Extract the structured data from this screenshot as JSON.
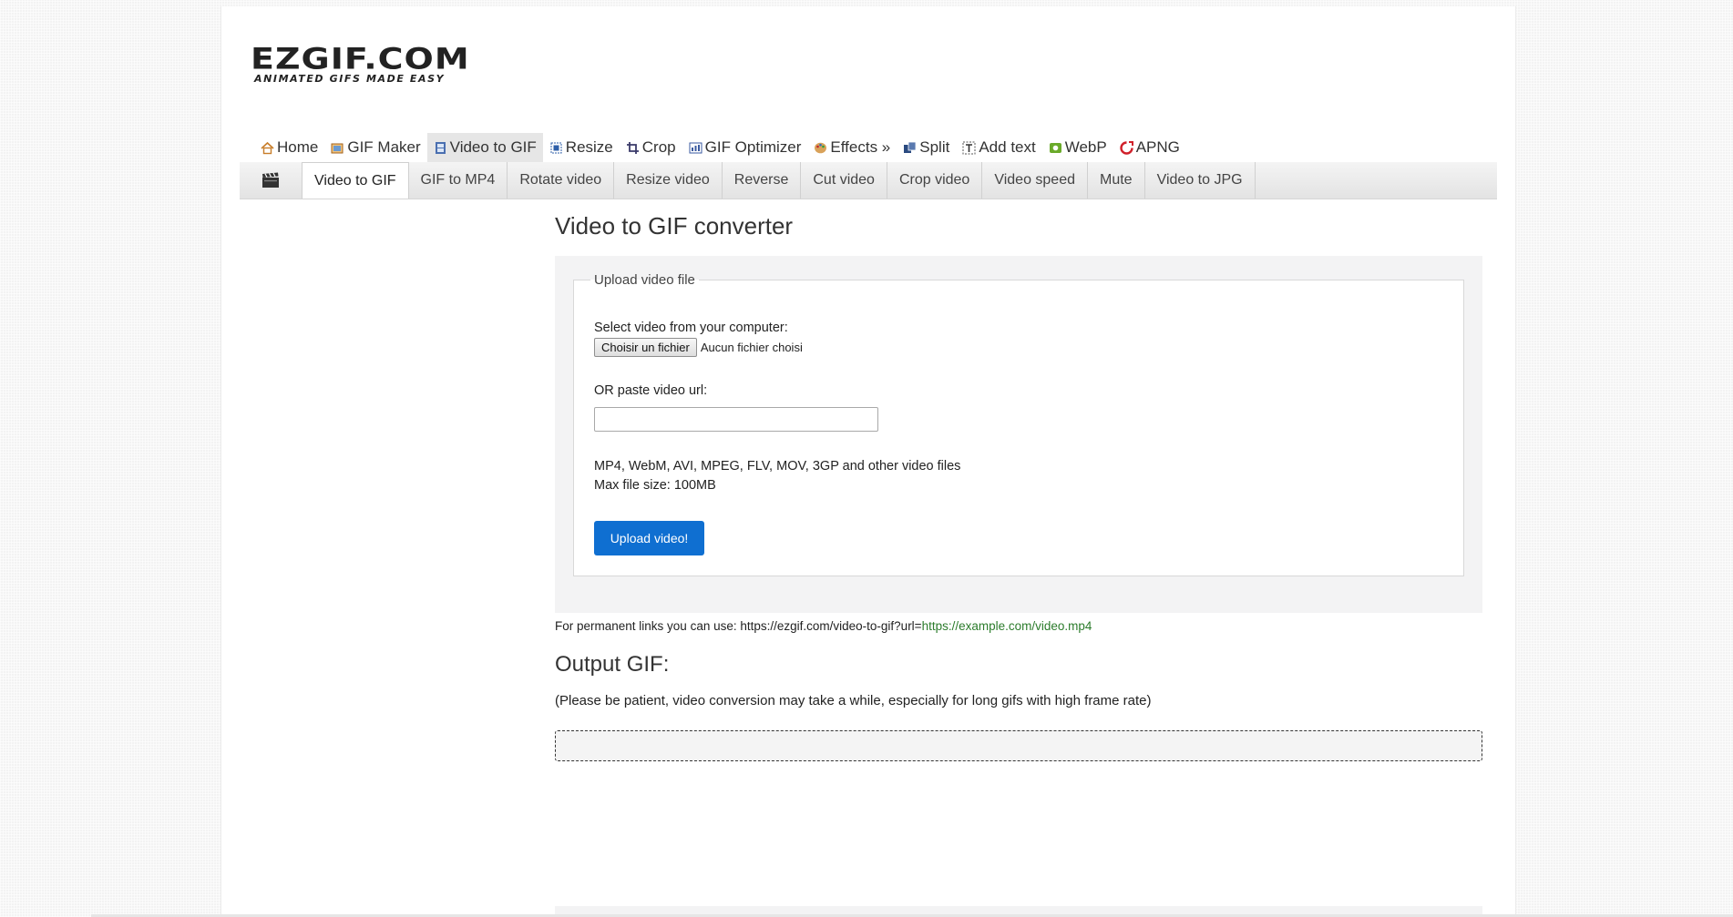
{
  "logo": {
    "name": "EZGIF.COM",
    "tagline": "ANIMATED GIFS MADE EASY"
  },
  "main_nav": {
    "items": [
      {
        "label": "Home",
        "icon": "home-icon",
        "color": "#c77d2a"
      },
      {
        "label": "GIF Maker",
        "icon": "gif-maker-icon",
        "color": "#d98c2b"
      },
      {
        "label": "Video to GIF",
        "icon": "film-strip-icon",
        "color": "#4a6fb0",
        "active": true
      },
      {
        "label": "Resize",
        "icon": "resize-icon",
        "color": "#2f5fa8"
      },
      {
        "label": "Crop",
        "icon": "crop-icon",
        "color": "#3a3a6a"
      },
      {
        "label": "GIF Optimizer",
        "icon": "optimizer-icon",
        "color": "#3a5aa0"
      },
      {
        "label": "Effects »",
        "icon": "palette-icon",
        "color": "#b07030"
      },
      {
        "label": "Split",
        "icon": "split-icon",
        "color": "#2a4a80"
      },
      {
        "label": "Add text",
        "icon": "add-text-icon",
        "color": "#555555"
      },
      {
        "label": "WebP",
        "icon": "webp-icon",
        "color": "#6aaa2a"
      },
      {
        "label": "APNG",
        "icon": "apng-icon",
        "color": "#d0202a"
      }
    ]
  },
  "sub_nav": {
    "icon": "clapperboard-icon",
    "items": [
      {
        "label": "Video to GIF",
        "active": true
      },
      {
        "label": "GIF to MP4"
      },
      {
        "label": "Rotate video"
      },
      {
        "label": "Resize video"
      },
      {
        "label": "Reverse"
      },
      {
        "label": "Cut video"
      },
      {
        "label": "Crop video"
      },
      {
        "label": "Video speed"
      },
      {
        "label": "Mute"
      },
      {
        "label": "Video to JPG"
      }
    ]
  },
  "main": {
    "title": "Video to GIF converter",
    "upload": {
      "legend": "Upload video file",
      "select_label": "Select video from your computer:",
      "file_button": "Choisir un fichier",
      "file_status": "Aucun fichier choisi",
      "url_label": "OR paste video url:",
      "url_value": "",
      "formats": "MP4, WebM, AVI, MPEG, FLV, MOV, 3GP and other video files",
      "max_size": "Max file size: 100MB",
      "submit": "Upload video!"
    },
    "permanent_links": {
      "prefix": "For permanent links you can use: https://ezgif.com/video-to-gif?url=",
      "example": "https://example.com/video.mp4"
    },
    "output": {
      "title": "Output GIF:",
      "note": "(Please be patient, video conversion may take a while, especially for long gifs with high frame rate)"
    }
  },
  "colors": {
    "accent_button": "#0f6fd1",
    "link_green": "#2c7c2c",
    "active_tab_bg": "#e6e6e6"
  }
}
